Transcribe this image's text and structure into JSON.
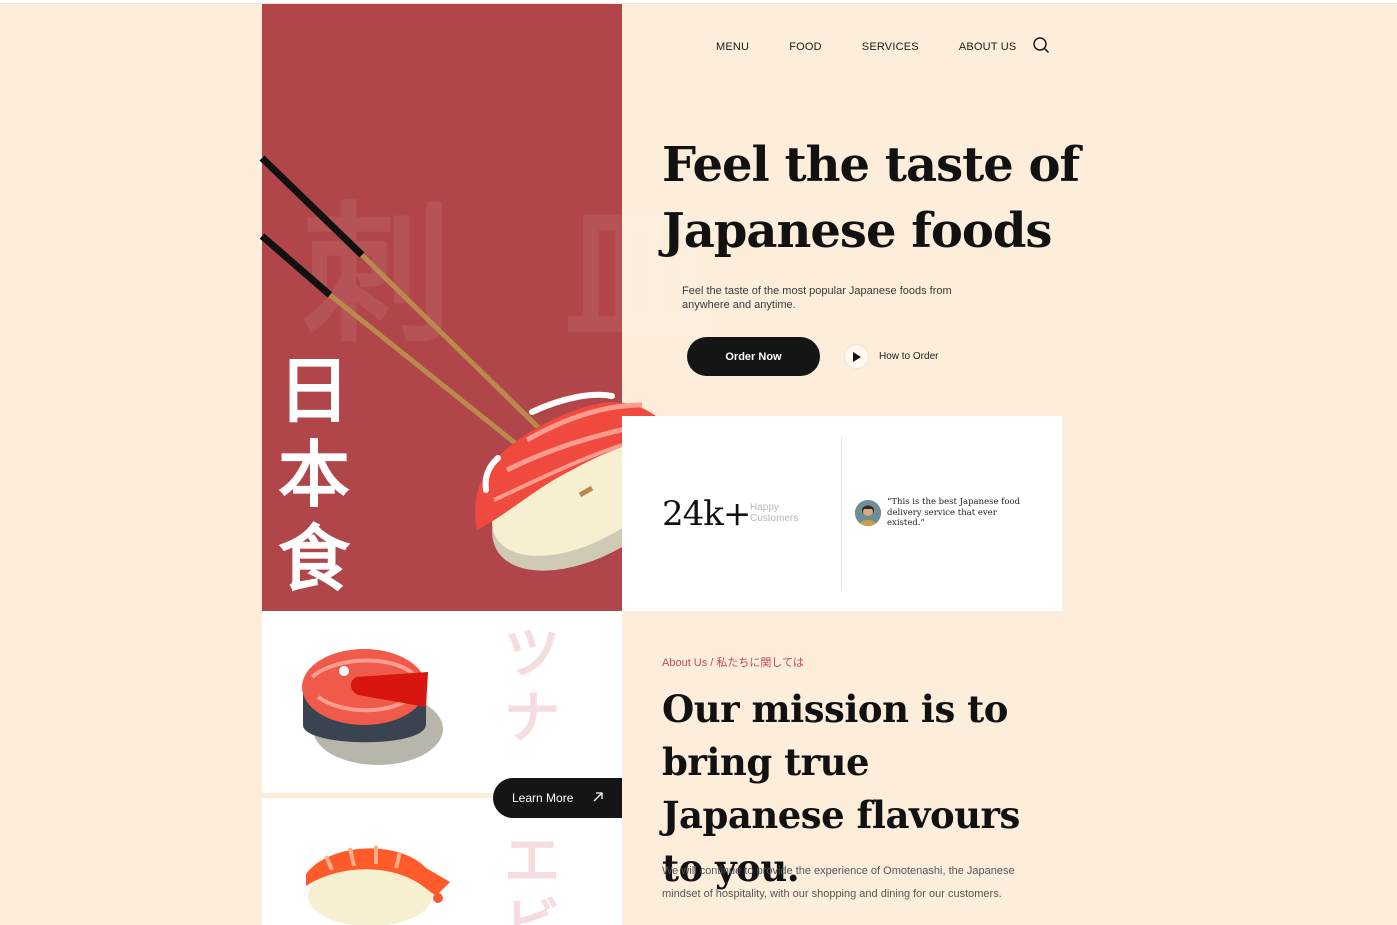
{
  "nav": {
    "items": [
      {
        "label": "MENU"
      },
      {
        "label": "FOOD"
      },
      {
        "label": "SERVICES"
      },
      {
        "label": "ABOUT US"
      }
    ],
    "search_icon": "search-icon"
  },
  "hero": {
    "bg_kanji": "刺 皿",
    "vertical_kanji": "日本食",
    "title": "Feel the taste of Japanese foods",
    "subtitle": "Feel the taste of the most popular Japanese foods from anywhere and anytime.",
    "order_button": "Order Now",
    "how_to_order": "How to Order",
    "accent_color": "#b0464a"
  },
  "stats": {
    "count": "24k+",
    "count_label": "Happy Customers",
    "quote": "“This is the best Japanese food delivery service that ever existed.”"
  },
  "cards": {
    "card1_kana": "ツナ",
    "card2_kana": "エビ",
    "learn_more": "Learn More"
  },
  "about": {
    "tag": "About Us / 私たちに関しては",
    "title": "Our mission is to bring true Japanese flavours to you.",
    "text": "We will continue to provide the experience of Omotenashi, the Japanese mindset of hospitality, with our shopping and dining for our customers."
  }
}
